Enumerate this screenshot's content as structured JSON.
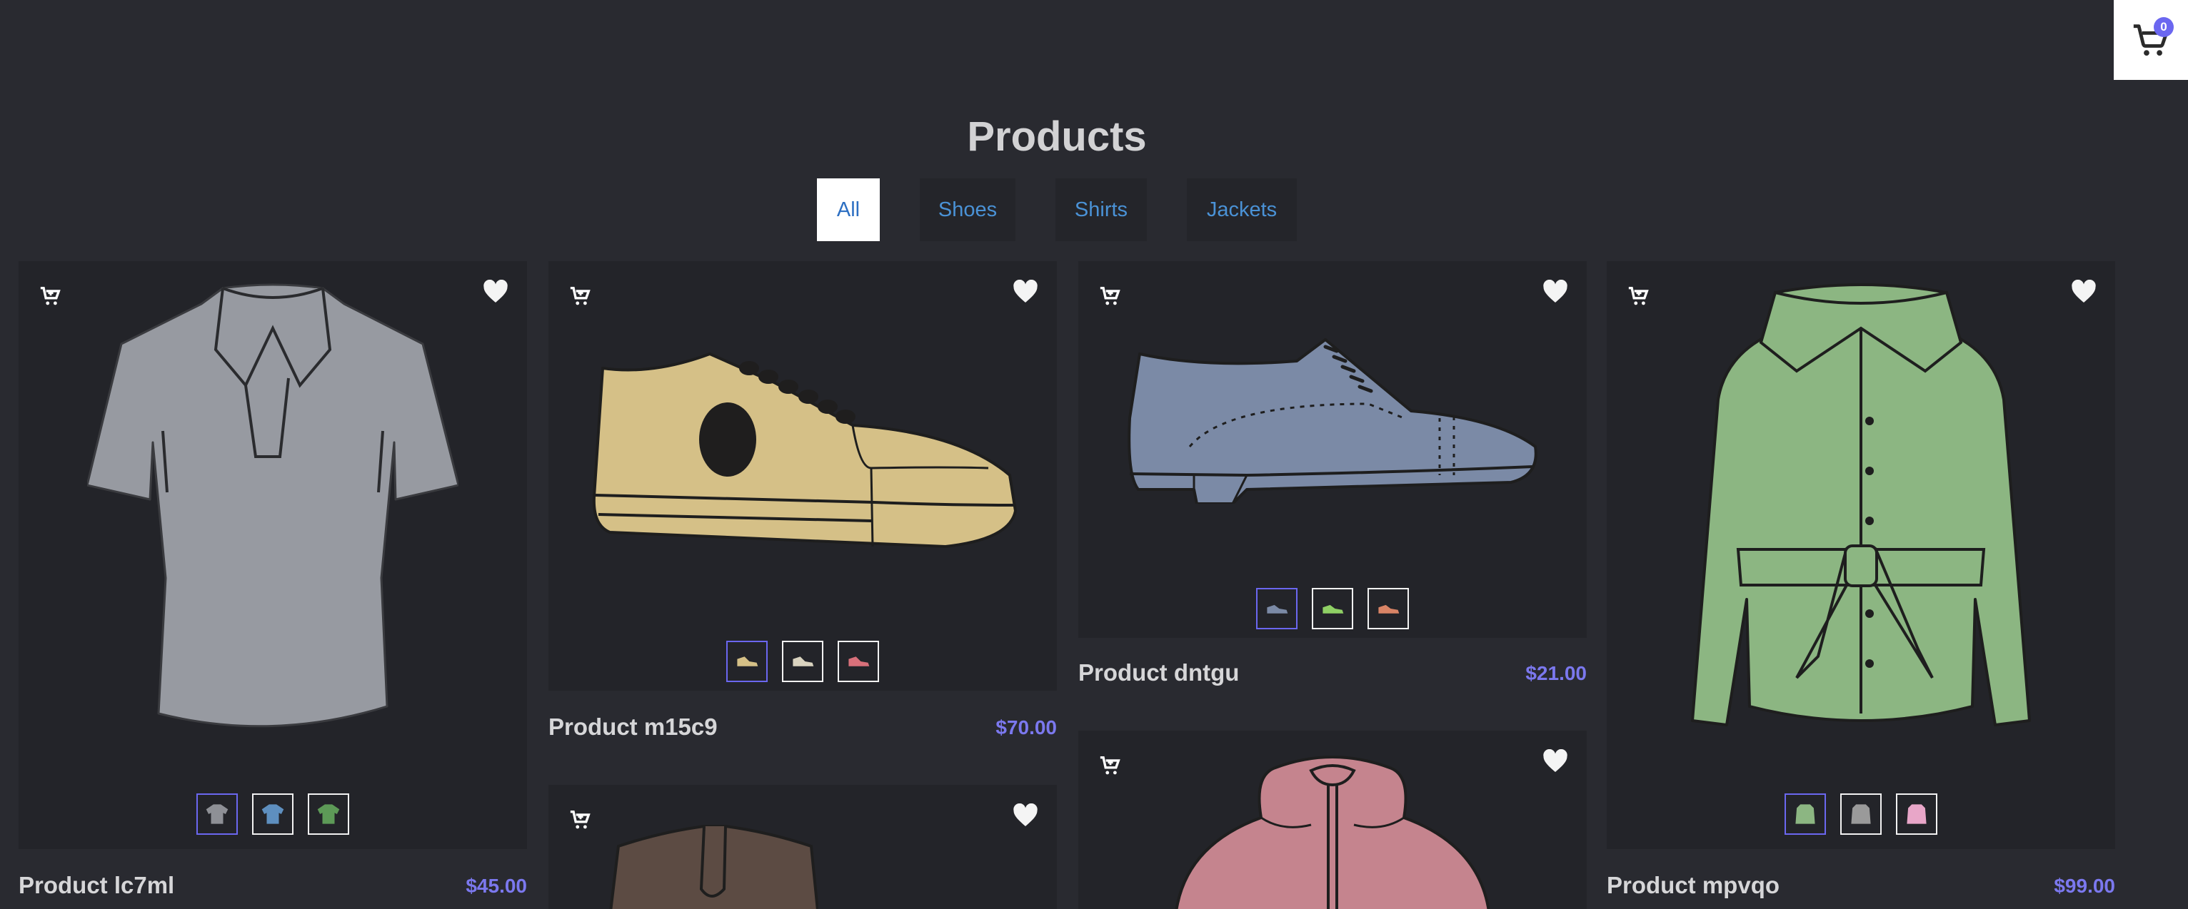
{
  "page": {
    "title": "Products"
  },
  "cart": {
    "count": "0"
  },
  "filters": [
    {
      "label": "All",
      "active": true
    },
    {
      "label": "Shoes"
    },
    {
      "label": "Shirts"
    },
    {
      "label": "Jackets"
    }
  ],
  "products": [
    {
      "name": "Product lc7ml",
      "price": "$45.00",
      "type": "shirt",
      "color": "#979aa1",
      "swatches": [
        "#8e9096",
        "#5e8fbf",
        "#5d9a57"
      ]
    },
    {
      "name": "Product m15c9",
      "price": "$70.00",
      "type": "sneaker",
      "color": "#d5c087",
      "swatches": [
        "#d5c087",
        "#d9d3bf",
        "#d8707a"
      ]
    },
    {
      "name": "Product dntgu",
      "price": "$21.00",
      "type": "oxford",
      "color": "#7b8aa6",
      "swatches": [
        "#7b8aa6",
        "#8fd065",
        "#d98466"
      ]
    },
    {
      "name": "Product mpvqo",
      "price": "$99.00",
      "type": "jacket",
      "color": "#8cb682",
      "swatches": [
        "#8cb682",
        "#9a9a9a",
        "#e8a6c8"
      ]
    },
    {
      "type": "brown-jacket",
      "color": "#5c4b43"
    },
    {
      "type": "pink-hoodie",
      "color": "#c5848e"
    }
  ],
  "icons": {
    "cart": "shopping-cart-icon",
    "add_to_cart": "cart-plus-icon",
    "wishlist": "heart-icon"
  },
  "colors": {
    "background": "#292a30",
    "card": "#232429",
    "accent": "#6b67f0",
    "filter_text": "#4a92d6"
  }
}
